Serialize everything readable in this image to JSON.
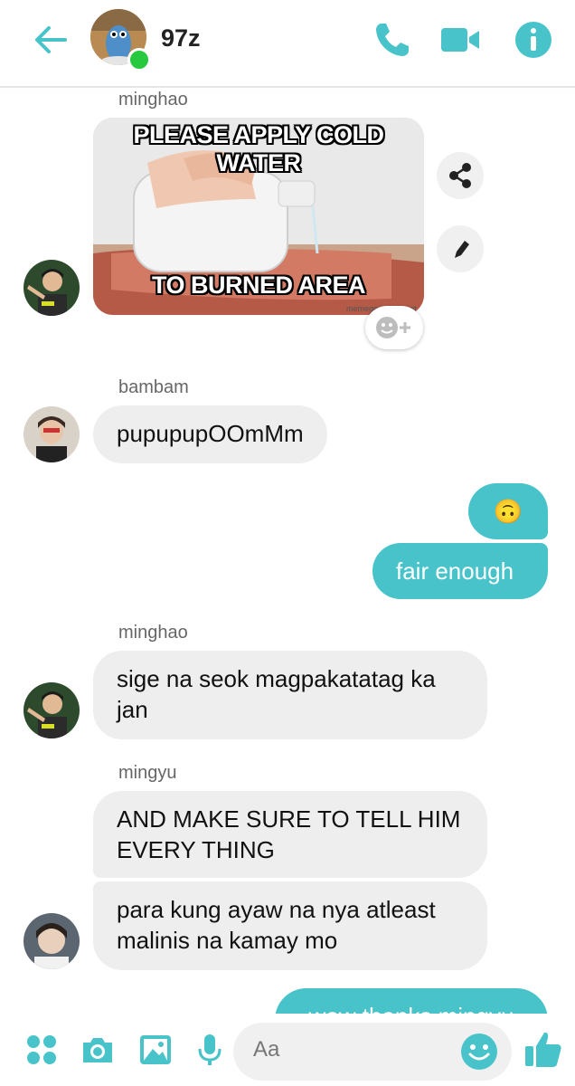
{
  "header": {
    "title": "97z"
  },
  "messages": [
    {
      "sender": "minghao",
      "meme_top": "PLEASE APPLY COLD WATER",
      "meme_bottom": "TO BURNED AREA",
      "watermark": "memegenerator.net"
    },
    {
      "sender": "bambam",
      "text": "pupupupOOmMm"
    },
    {
      "out_emoji": "🙃",
      "out_text": "fair enough"
    },
    {
      "sender": "minghao",
      "text": "sige na seok magpakatatag ka jan"
    },
    {
      "sender": "mingyu",
      "text1": "AND MAKE SURE TO TELL HIM EVERY THING",
      "text2": "para kung ayaw na nya atleast malinis na kamay mo"
    },
    {
      "out_text_partial": "wow thanks mingyu"
    }
  ],
  "composer": {
    "placeholder": "Aa"
  },
  "colors": {
    "accent": "#47c3c9",
    "incoming_bubble": "#eeeeee"
  },
  "icons": [
    "back-arrow-icon",
    "phone-icon",
    "video-camera-icon",
    "info-icon",
    "share-icon",
    "pencil-icon",
    "add-reaction-icon",
    "apps-icon",
    "camera-icon",
    "gallery-icon",
    "microphone-icon",
    "emoji-icon",
    "thumbs-up-icon"
  ]
}
